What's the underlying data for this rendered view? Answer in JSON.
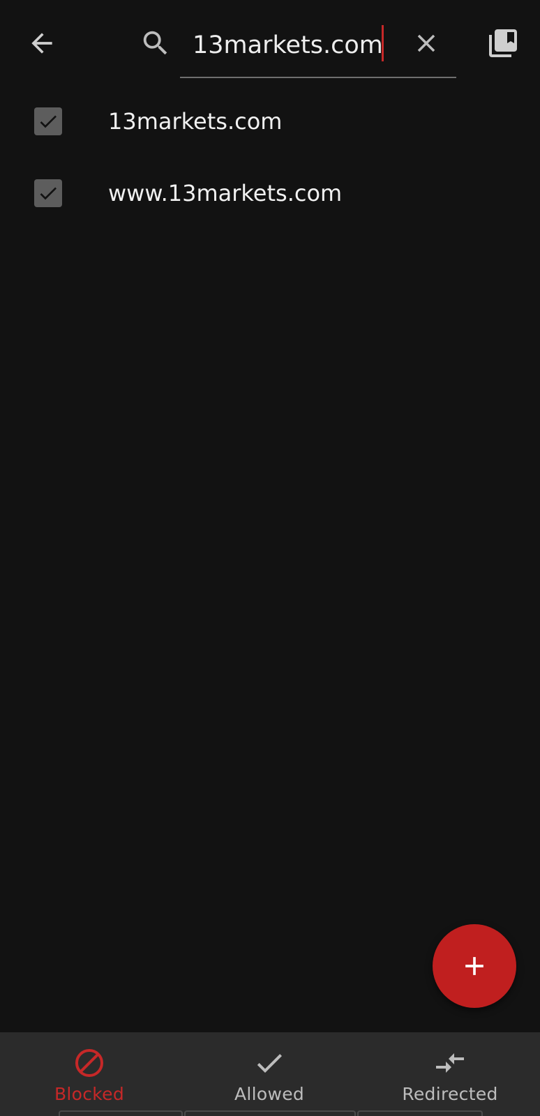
{
  "search": {
    "value": "13markets.com",
    "placeholder": ""
  },
  "icons": {
    "back": "arrow-left-icon",
    "search": "search-icon",
    "clear": "close-icon",
    "bookmarks": "library-bookmark-icon",
    "add": "plus-icon"
  },
  "hosts": [
    {
      "label": "13markets.com",
      "checked": true
    },
    {
      "label": "www.13markets.com",
      "checked": true
    }
  ],
  "bottom_nav": {
    "blocked": "Blocked",
    "allowed": "Allowed",
    "redirected": "Redirected",
    "active": "blocked"
  },
  "colors": {
    "background": "#121212",
    "accent": "#c62828",
    "fab": "#c01f1f",
    "nav_background": "#2b2b2b"
  }
}
